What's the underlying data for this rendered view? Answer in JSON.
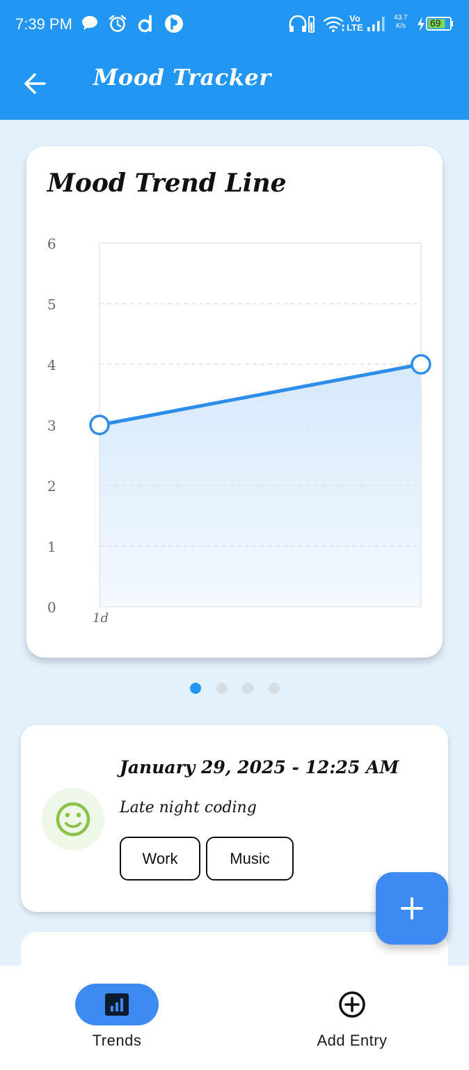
{
  "status_bar": {
    "time": "7:39 PM",
    "net_speed_value": "43.7",
    "net_speed_unit": "K/s",
    "volte_top": "Vo",
    "volte_bottom": "LTE",
    "battery": "69",
    "icons": [
      "chat-bubble-icon",
      "alarm-icon",
      "d-app-icon",
      "p-app-icon",
      "headphones-icon",
      "wifi-icon",
      "signal-icon",
      "charging-icon",
      "battery-icon"
    ]
  },
  "app_bar": {
    "title": "Mood Tracker",
    "back_icon": "arrow-left-icon"
  },
  "chart_card": {
    "title": "Mood Trend Line"
  },
  "chart_data": {
    "type": "area",
    "title": "Mood Trend Line",
    "x_tick_labels": [
      "1d"
    ],
    "y_tick_labels": [
      "0",
      "1",
      "2",
      "3",
      "4",
      "5",
      "6"
    ],
    "ylim": [
      0,
      6
    ],
    "grid": true,
    "series": [
      {
        "values": [
          3,
          4
        ]
      }
    ],
    "colors": {
      "line": "#2d8de8",
      "fill": "#d6e9fb"
    }
  },
  "pager": {
    "count": 4,
    "active_index": 0
  },
  "entry": {
    "date": "January 29, 2025 - 12:25 AM",
    "note": "Late night coding",
    "mood_icon": "smiley-face-icon",
    "tags": [
      "Work",
      "Music"
    ]
  },
  "fab": {
    "icon": "plus-icon"
  },
  "bottom_nav": {
    "items": [
      {
        "label": "Trends",
        "icon": "bar-chart-icon",
        "active": true
      },
      {
        "label": "Add Entry",
        "icon": "add-circle-icon",
        "active": false
      }
    ]
  },
  "colors": {
    "primary": "#2196f3",
    "accent": "#3d8bf2",
    "background": "#e3f1fd",
    "mood_green": "#8bc34a"
  }
}
